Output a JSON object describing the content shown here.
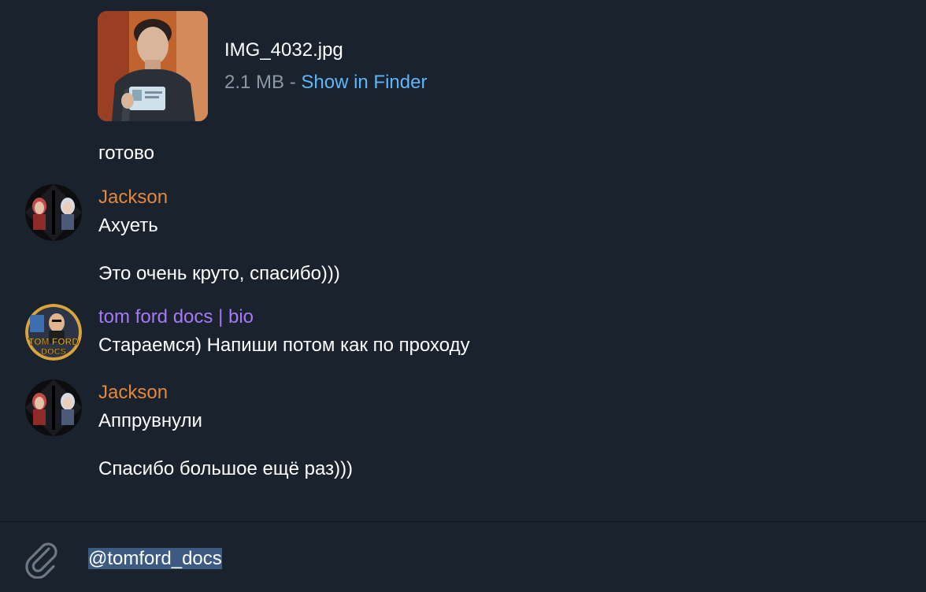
{
  "file_message": {
    "file_name": "IMG_4032.jpg",
    "file_size": "2.1 MB",
    "separator": " - ",
    "show_in_finder": "Show in Finder",
    "caption": "готово"
  },
  "messages": [
    {
      "author": "Jackson",
      "author_color": "#e3883e",
      "lines": [
        "Ахуеть",
        "Это очень круто, спасибо)))"
      ]
    },
    {
      "author": "tom ford docs | bio",
      "author_color": "#a57af5",
      "avatar_text": "TOM FORD DOCS",
      "lines": [
        "Стараемся) Напиши потом как по проходу"
      ]
    },
    {
      "author": "Jackson",
      "author_color": "#e3883e",
      "lines": [
        "Аппрувнули",
        "Спасибо большое ещё раз)))"
      ]
    }
  ],
  "composer": {
    "attach_icon": "paperclip-icon",
    "input_value": "@tomford_docs"
  },
  "colors": {
    "background": "#1a222d",
    "link": "#5eb5f7",
    "meta": "#8d98a5",
    "selection": "#3d5b82"
  }
}
